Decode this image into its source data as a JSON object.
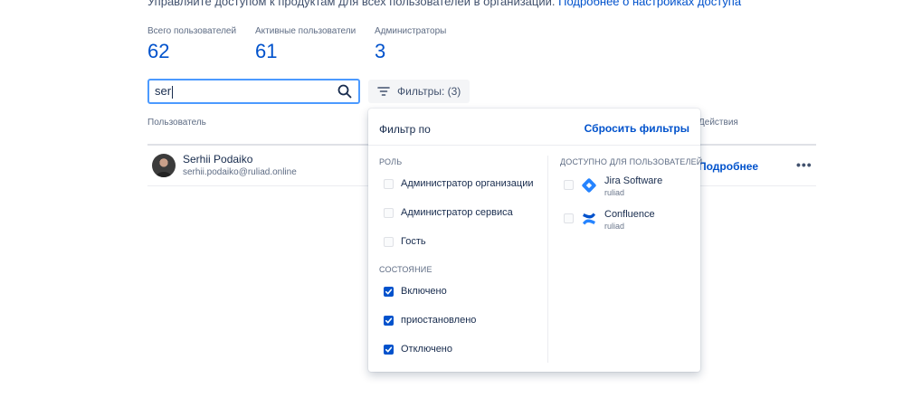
{
  "intro": {
    "text": "Управляйте доступом к продуктам для всех пользователей в организации.",
    "link": "Подробнее о настройках доступа"
  },
  "stats": [
    {
      "label": "Всего пользователей",
      "value": "62"
    },
    {
      "label": "Активные пользователи",
      "value": "61"
    },
    {
      "label": "Администраторы",
      "value": "3"
    }
  ],
  "search": {
    "value": "ser"
  },
  "filters_button": {
    "label": "Фильтры: (3)"
  },
  "table": {
    "columns": {
      "user": "Пользователь",
      "actions": "Действия"
    },
    "rows": [
      {
        "name": "Serhii Podaiko",
        "email": "serhii.podaiko@ruliad.online",
        "details": "Подробнее"
      }
    ]
  },
  "filter_panel": {
    "title": "Фильтр по",
    "reset": "Сбросить фильтры",
    "role_title": "Роль",
    "roles": [
      {
        "label": "Администратор организации",
        "checked": false
      },
      {
        "label": "Администратор сервиса",
        "checked": false
      },
      {
        "label": "Гость",
        "checked": false
      }
    ],
    "status_title": "Состояние",
    "statuses": [
      {
        "label": "Включено",
        "checked": true
      },
      {
        "label": "приостановлено",
        "checked": true
      },
      {
        "label": "Отключено",
        "checked": true
      }
    ],
    "products_title": "Доступно для пользователей",
    "products": [
      {
        "name": "Jira Software",
        "site": "ruliad",
        "checked": false,
        "icon": "jira-software-icon"
      },
      {
        "name": "Confluence",
        "site": "ruliad",
        "checked": false,
        "icon": "confluence-icon"
      }
    ]
  },
  "colors": {
    "accent": "#0052cc",
    "focus": "#4c9aff"
  }
}
